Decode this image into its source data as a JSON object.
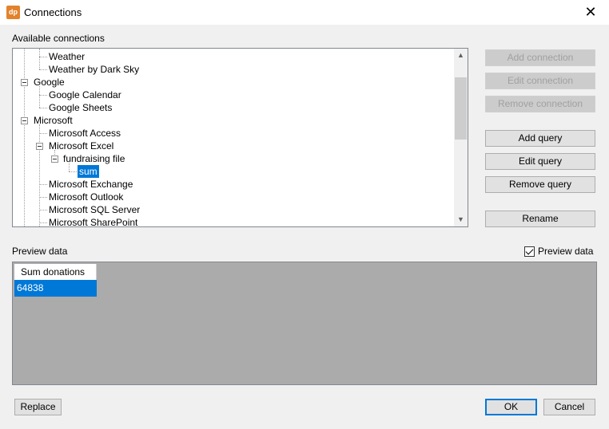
{
  "window": {
    "title": "Connections",
    "app_icon_text": "dp"
  },
  "tree": {
    "section_label": "Available connections",
    "items": [
      {
        "label": "Weather"
      },
      {
        "label": "Weather by Dark Sky"
      },
      {
        "label": "Google"
      },
      {
        "label": "Google Calendar"
      },
      {
        "label": "Google Sheets"
      },
      {
        "label": "Microsoft"
      },
      {
        "label": "Microsoft Access"
      },
      {
        "label": "Microsoft Excel"
      },
      {
        "label": "fundraising file"
      },
      {
        "label": "sum"
      },
      {
        "label": "Microsoft Exchange"
      },
      {
        "label": "Microsoft Outlook"
      },
      {
        "label": "Microsoft SQL Server"
      },
      {
        "label": "Microsoft SharePoint"
      }
    ]
  },
  "buttons": {
    "add_connection": "Add connection",
    "edit_connection": "Edit connection",
    "remove_connection": "Remove connection",
    "add_query": "Add query",
    "edit_query": "Edit query",
    "remove_query": "Remove query",
    "rename": "Rename",
    "replace": "Replace",
    "ok": "OK",
    "cancel": "Cancel"
  },
  "preview": {
    "section_label": "Preview data",
    "checkbox_label": "Preview data",
    "checked": true,
    "columns": [
      "Sum donations"
    ],
    "rows": [
      [
        "64838"
      ]
    ]
  },
  "colors": {
    "selection": "#0078d7",
    "app_icon": "#e2832c"
  }
}
